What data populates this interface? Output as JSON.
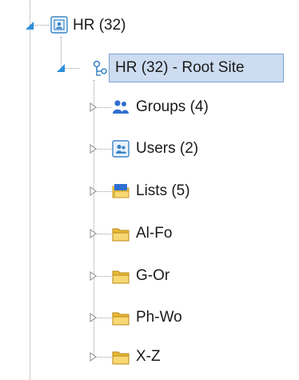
{
  "tree": {
    "site": {
      "label": "HR (32)",
      "icon": "site-collection-icon"
    },
    "root_site": {
      "label": "HR (32) - Root Site",
      "icon": "site-icon"
    },
    "children": [
      {
        "label": "Groups (4)",
        "icon": "groups-icon"
      },
      {
        "label": "Users (2)",
        "icon": "users-icon"
      },
      {
        "label": "Lists (5)",
        "icon": "lists-icon"
      },
      {
        "label": "Al-Fo",
        "icon": "folder-icon"
      },
      {
        "label": "G-Or",
        "icon": "folder-icon"
      },
      {
        "label": "Ph-Wo",
        "icon": "folder-icon"
      },
      {
        "label": "X-Z",
        "icon": "folder-icon"
      }
    ]
  },
  "colors": {
    "selection_bg": "#cddcf0",
    "selection_border": "#7da2ce",
    "expander_blue": "#2a8fd8",
    "folder_yellow": "#f2c94c"
  }
}
